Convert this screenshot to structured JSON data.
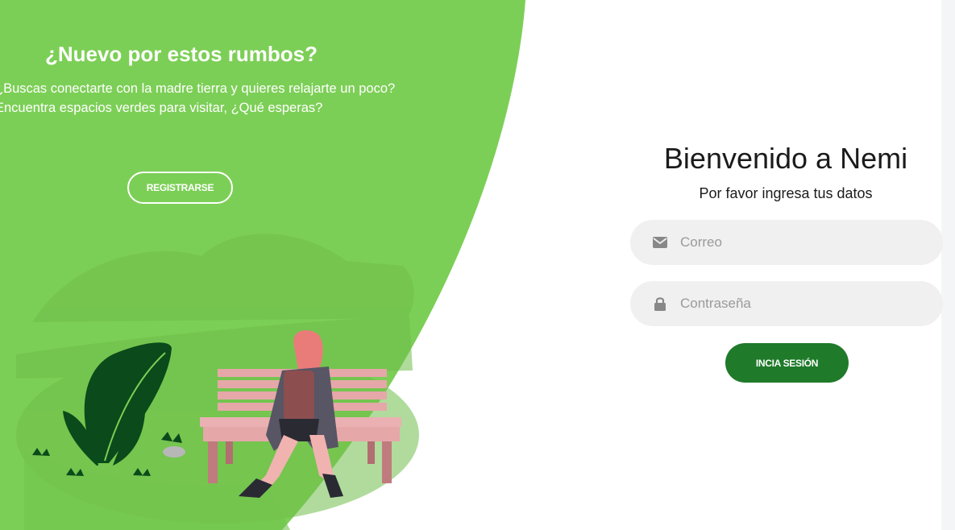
{
  "signup": {
    "title": "¿Nuevo por estos rumbos?",
    "line1": "¿Buscas conectarte con la madre tierra y quieres relajarte un poco?",
    "line2": "Encuentra espacios verdes para visitar, ¿Qué esperas?",
    "button": "REGISTRARSE"
  },
  "login": {
    "title": "Bienvenido a Nemi",
    "subtitle": "Por favor ingresa tus datos",
    "email_placeholder": "Correo",
    "email_icon": "envelope-icon",
    "password_placeholder": "Contraseña",
    "password_icon": "lock-icon",
    "button": "INCIA SESIÓN"
  },
  "colors": {
    "green_panel": "#7ccf56",
    "dark_green_button": "#1f7a2a",
    "field_background": "#f0f0f0"
  }
}
